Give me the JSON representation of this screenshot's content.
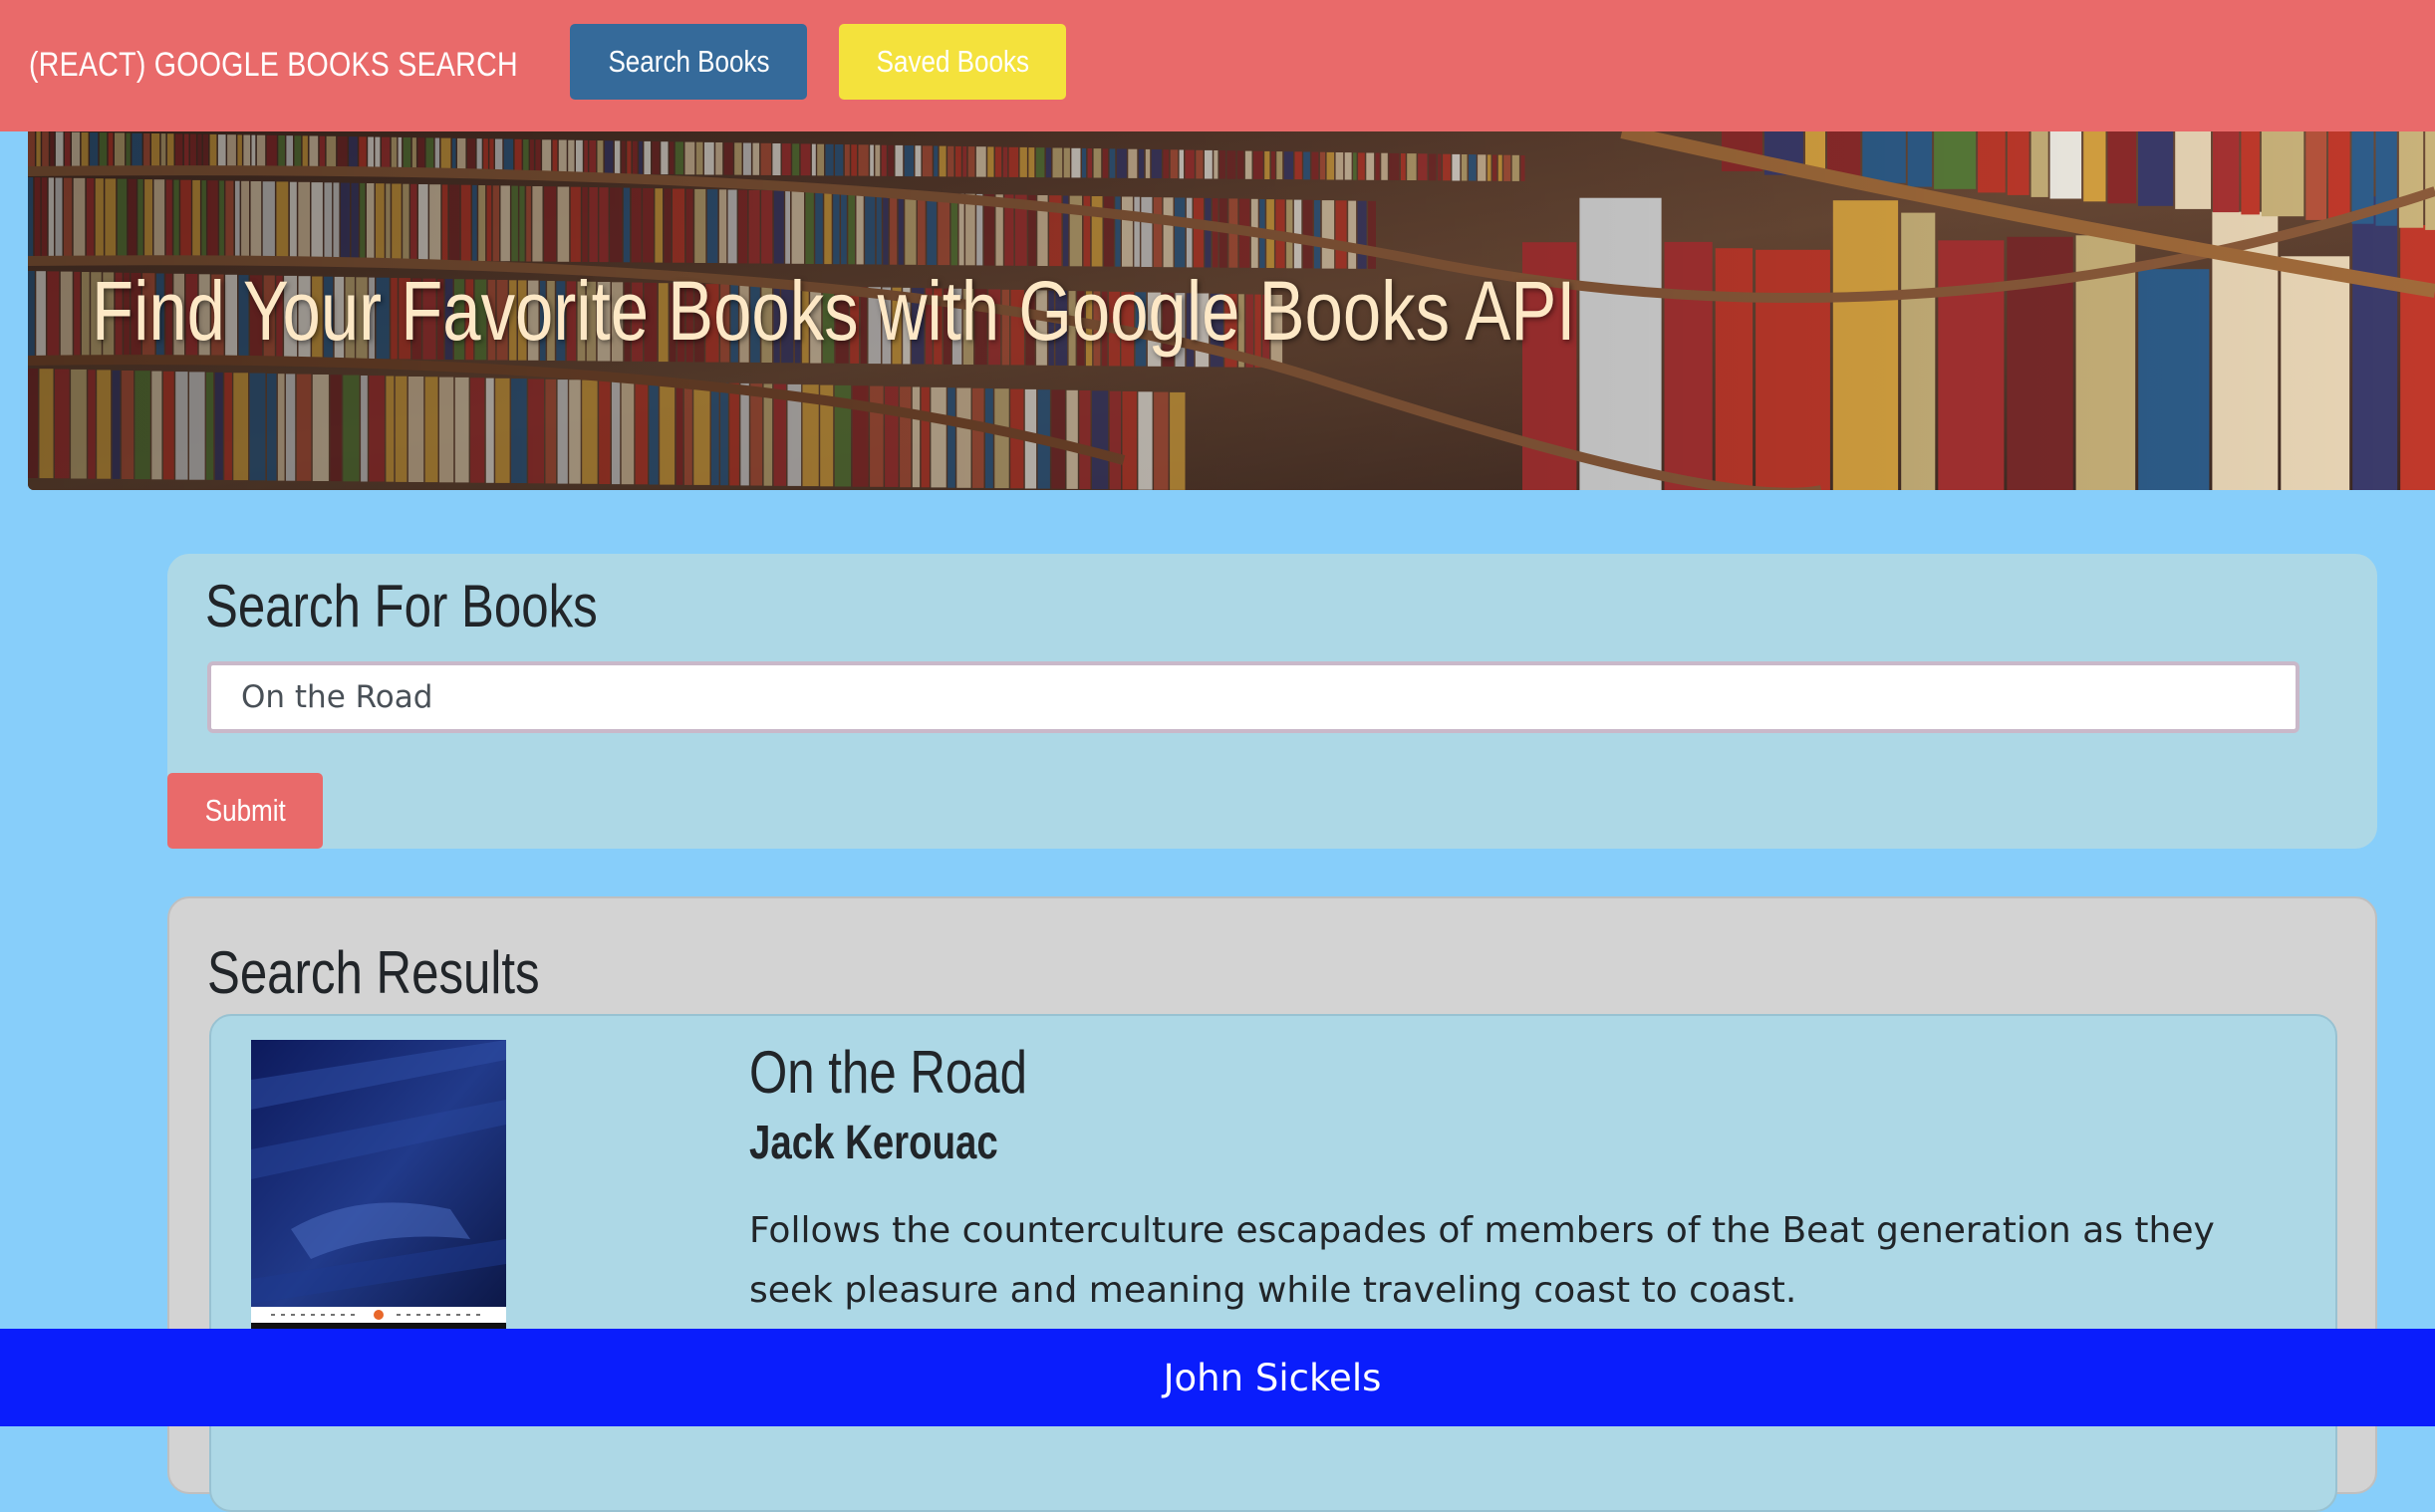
{
  "navbar": {
    "brand": "(REACT) GOOGLE BOOKS SEARCH",
    "search_books_label": "Search Books",
    "saved_books_label": "Saved Books",
    "search_books_color": "#356a9a",
    "saved_books_color": "#f4e23c",
    "background_color": "#e96a6a"
  },
  "hero": {
    "title": "Find Your Favorite Books with Google Books API",
    "background": "library-bookshelves-image"
  },
  "search": {
    "heading": "Search For Books",
    "input_value": "On the Road",
    "submit_label": "Submit"
  },
  "results": {
    "heading": "Search Results",
    "books": [
      {
        "title": "On the Road",
        "author": "Jack Kerouac",
        "description": "Follows the counterculture escapades of members of the Beat generation as they seek pleasure and meaning while traveling coast to coast.",
        "cover": "book-cover-thumbnail"
      }
    ]
  },
  "footer": {
    "text": "John Sickels",
    "background_color": "#0a1dfc"
  },
  "colors": {
    "page_background": "#87cefa",
    "card_background": "#add8e6",
    "results_background": "#d3d3d3"
  }
}
